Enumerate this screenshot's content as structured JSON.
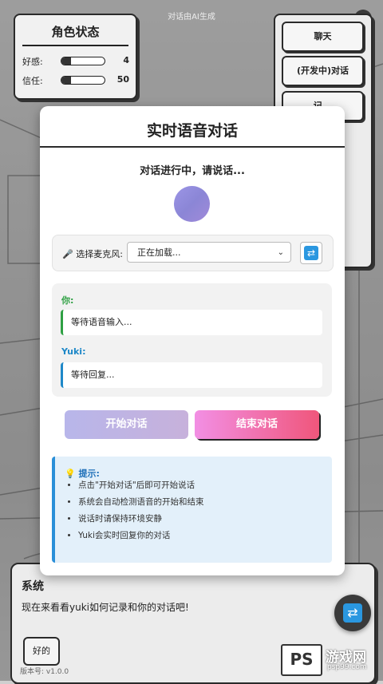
{
  "header": {
    "note": "对话由AI生成",
    "close_label": "×"
  },
  "status_panel": {
    "title": "角色状态",
    "stats": [
      {
        "label": "好感:",
        "value": "4",
        "level": 0.22
      },
      {
        "label": "信任:",
        "value": "50",
        "level": 0.22
      }
    ]
  },
  "menu": {
    "items": [
      "聊天",
      "(开发中)对话",
      "记..."
    ]
  },
  "modal": {
    "title": "实时语音对话",
    "status": "对话进行中，请说话...",
    "mic": {
      "label": "🎤 选择麦克风:",
      "selected": "正在加载...",
      "refresh_icon": "refresh-icon"
    },
    "conversation": {
      "user_label": "你:",
      "user_text": "等待语音输入...",
      "ai_label": "Yuki:",
      "ai_text": "等待回复..."
    },
    "buttons": {
      "start": "开始对话",
      "end": "结束对话"
    },
    "tips": {
      "title": "💡 提示:",
      "items": [
        "点击\"开始对话\"后即可开始说话",
        "系统会自动检测语音的开始和结束",
        "说话时请保持环境安静",
        "Yuki会实时回复你的对话"
      ]
    }
  },
  "system_panel": {
    "title": "系统",
    "text": "现在来看看yuki如何记录和你的对话吧!",
    "ok_label": "好的",
    "version": "版本号: v1.0.0"
  },
  "watermark": {
    "logo": "PS",
    "name": "游戏网",
    "url": "psp99.com"
  },
  "colors": {
    "accent_blue": "#2a8fd8",
    "user_green": "#2ea043",
    "ai_blue": "#1e88c8",
    "end_pink": "#f0567b"
  }
}
